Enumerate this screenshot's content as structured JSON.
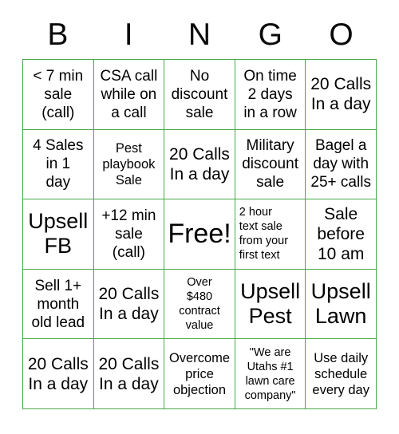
{
  "card": {
    "title_letters": [
      "B",
      "I",
      "N",
      "G",
      "O"
    ],
    "accent_color": "#4aa84a",
    "text_color": "#000000",
    "background_color": "#ffffff",
    "grid_size": "5x5",
    "free_space_label": "Free!",
    "free_space_position": "center"
  },
  "squares": [
    {
      "text": "< 7 min\nsale\n(call)",
      "size": "sm",
      "align": "center",
      "row": 1,
      "col": "B"
    },
    {
      "text": "CSA call\nwhile on\na call",
      "size": "sm",
      "align": "center",
      "row": 1,
      "col": "I"
    },
    {
      "text": "No\ndiscount\nsale",
      "size": "sm",
      "align": "center",
      "row": 1,
      "col": "N"
    },
    {
      "text": "On time\n2 days\nin a row",
      "size": "sm",
      "align": "center",
      "row": 1,
      "col": "G"
    },
    {
      "text": "20 Calls\nIn a day",
      "size": "md",
      "align": "center",
      "row": 1,
      "col": "O"
    },
    {
      "text": "4 Sales\nin 1\nday",
      "size": "sm",
      "align": "center",
      "row": 2,
      "col": "B"
    },
    {
      "text": "Pest\nplaybook\nSale",
      "size": "xs",
      "align": "center",
      "row": 2,
      "col": "I"
    },
    {
      "text": "20 Calls\nIn a day",
      "size": "md",
      "align": "center",
      "row": 2,
      "col": "N"
    },
    {
      "text": "Military\ndiscount\nsale",
      "size": "sm",
      "align": "center",
      "row": 2,
      "col": "G"
    },
    {
      "text": "Bagel a\nday with\n25+ calls",
      "size": "sm",
      "align": "center",
      "row": 2,
      "col": "O"
    },
    {
      "text": "Upsell\nFB",
      "size": "lg",
      "align": "center",
      "row": 3,
      "col": "B"
    },
    {
      "text": "+12 min\nsale\n(call)",
      "size": "sm",
      "align": "center",
      "row": 3,
      "col": "I"
    },
    {
      "text": "Free!",
      "size": "xl",
      "align": "center",
      "row": 3,
      "col": "N"
    },
    {
      "text": "2 hour\ntext sale\nfrom your\nfirst text",
      "size": "xxs",
      "align": "left",
      "row": 3,
      "col": "G"
    },
    {
      "text": "Sale\nbefore\n10 am",
      "size": "md",
      "align": "center",
      "row": 3,
      "col": "O"
    },
    {
      "text": "Sell 1+\nmonth\nold lead",
      "size": "sm",
      "align": "center",
      "row": 4,
      "col": "B"
    },
    {
      "text": "20 Calls\nIn a day",
      "size": "md",
      "align": "center",
      "row": 4,
      "col": "I"
    },
    {
      "text": "Over\n$480\ncontract\nvalue",
      "size": "xxs",
      "align": "center",
      "row": 4,
      "col": "N"
    },
    {
      "text": "Upsell\nPest",
      "size": "lg",
      "align": "center",
      "row": 4,
      "col": "G"
    },
    {
      "text": "Upsell\nLawn",
      "size": "lg",
      "align": "center",
      "row": 4,
      "col": "O"
    },
    {
      "text": "20 Calls\nIn a day",
      "size": "md",
      "align": "center",
      "row": 5,
      "col": "B"
    },
    {
      "text": "20 Calls\nIn a day",
      "size": "md",
      "align": "center",
      "row": 5,
      "col": "I"
    },
    {
      "text": "Overcome\nprice\nobjection",
      "size": "xs",
      "align": "center",
      "row": 5,
      "col": "N"
    },
    {
      "text": "\"We are\nUtahs #1\nlawn care\ncompany\"",
      "size": "xxs",
      "align": "center",
      "row": 5,
      "col": "G"
    },
    {
      "text": "Use daily\nschedule\nevery day",
      "size": "xs",
      "align": "center",
      "row": 5,
      "col": "O"
    }
  ]
}
